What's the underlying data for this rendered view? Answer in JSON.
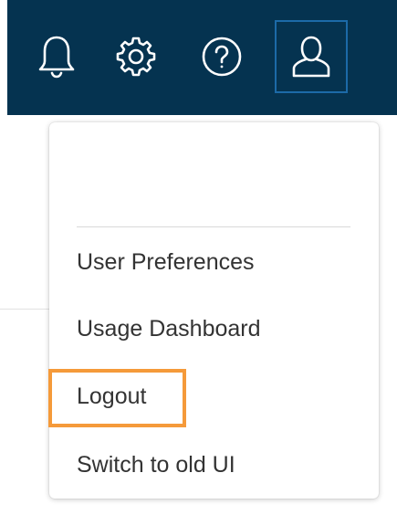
{
  "topbar": {
    "background": "#053350",
    "icons": [
      {
        "name": "bell-icon",
        "label": "Notifications"
      },
      {
        "name": "gear-icon",
        "label": "Settings"
      },
      {
        "name": "help-icon",
        "label": "Help"
      },
      {
        "name": "user-icon",
        "label": "Account"
      }
    ]
  },
  "dropdown": {
    "items": [
      {
        "label": "User Preferences"
      },
      {
        "label": "Usage Dashboard"
      },
      {
        "label": "Logout"
      },
      {
        "label": "Switch to old UI"
      }
    ],
    "highlighted_item": "Logout",
    "highlight_color": "#f59a3a"
  }
}
